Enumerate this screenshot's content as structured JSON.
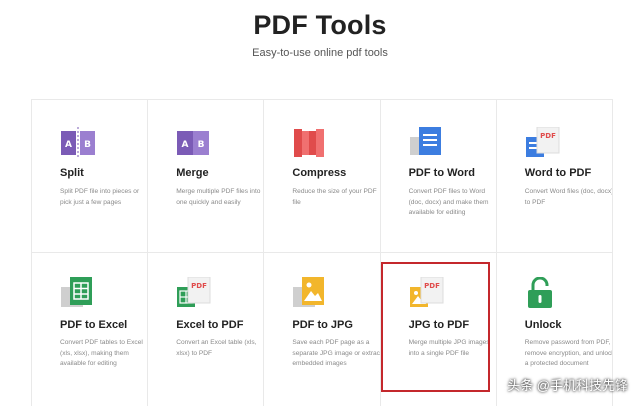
{
  "header": {
    "title": "PDF Tools",
    "subtitle": "Easy-to-use online pdf tools"
  },
  "tools": [
    {
      "name": "Split",
      "desc": "Split PDF file into pieces or pick just a few pages",
      "icon": "split-icon"
    },
    {
      "name": "Merge",
      "desc": "Merge multiple PDF files into one quickly and easily",
      "icon": "merge-icon"
    },
    {
      "name": "Compress",
      "desc": "Reduce the size of your PDF file",
      "icon": "compress-icon"
    },
    {
      "name": "PDF to Word",
      "desc": "Convert PDF files to Word (doc, docx) and make them available for editing",
      "icon": "word-doc-icon"
    },
    {
      "name": "Word to PDF",
      "desc": "Convert Word files (doc, docx) to PDF",
      "icon": "word-to-pdf-icon"
    },
    {
      "name": "PDF to Excel",
      "desc": "Convert PDF tables to Excel (xls, xlsx), making them available for editing",
      "icon": "excel-doc-icon"
    },
    {
      "name": "Excel to PDF",
      "desc": "Convert an Excel table (xls, xlsx) to PDF",
      "icon": "excel-to-pdf-icon"
    },
    {
      "name": "PDF to JPG",
      "desc": "Save each PDF page as a separate JPG image or extract embedded images",
      "icon": "jpg-image-icon"
    },
    {
      "name": "JPG to PDF",
      "desc": "Merge multiple JPG images into a single PDF file",
      "icon": "jpg-to-pdf-icon"
    },
    {
      "name": "Unlock",
      "desc": "Remove password from PDF, remove encryption, and unlock a protected document",
      "icon": "unlock-icon"
    }
  ],
  "watermark": "头条 @手机科技先锋",
  "colors": {
    "split": "#7b5bb6",
    "merge": "#7b5bb6",
    "compress": "#e04b4b",
    "word": "#3c7de0",
    "excel": "#2f9e58",
    "jpg": "#f2b62c",
    "unlock": "#2f9e58",
    "highlight": "#c4282c"
  }
}
